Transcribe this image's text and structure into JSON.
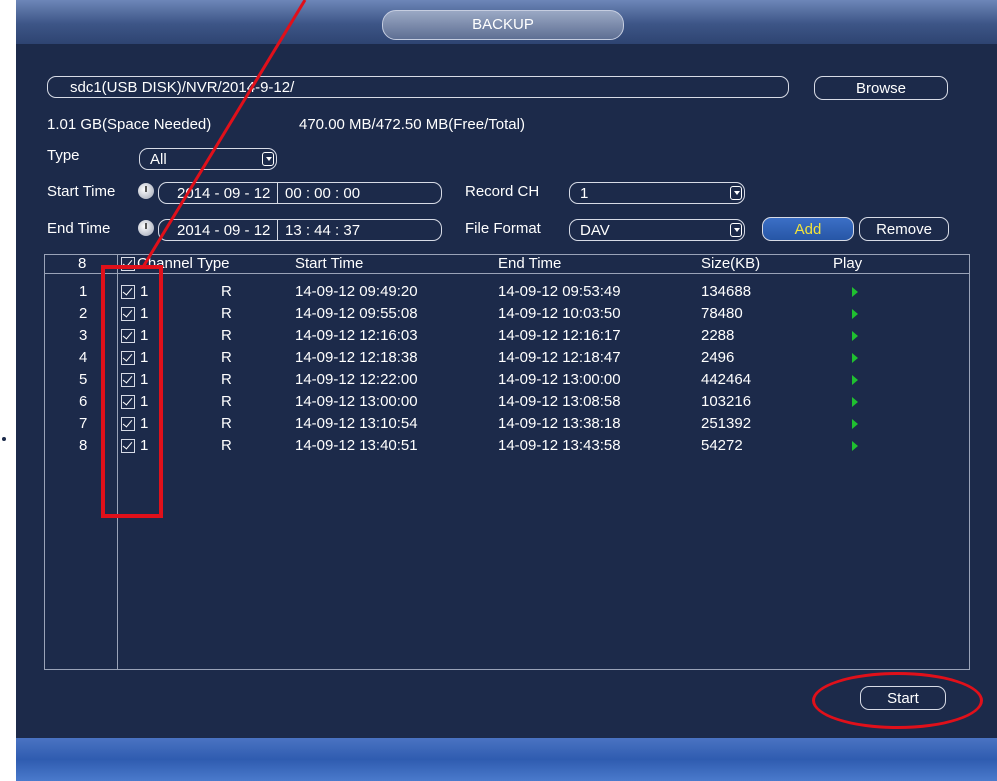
{
  "window": {
    "title": "BACKUP"
  },
  "path_bar": {
    "value": "sdc1(USB DISK)/NVR/2014-9-12/",
    "browse_label": "Browse"
  },
  "space": {
    "needed": "1.01 GB(Space Needed)",
    "free_total": "470.00 MB/472.50 MB(Free/Total)"
  },
  "filters": {
    "type_label": "Type",
    "type_value": "All",
    "start_time_label": "Start Time",
    "start_date": "2014 - 09 - 12",
    "start_time": "00 : 00 : 00",
    "end_time_label": "End Time",
    "end_date": "2014 - 09 - 12",
    "end_time": "13 : 44 : 37",
    "record_ch_label": "Record CH",
    "record_ch_value": "1",
    "file_format_label": "File Format",
    "file_format_value": "DAV",
    "add_label": "Add",
    "remove_label": "Remove"
  },
  "table": {
    "count": "8",
    "headers": {
      "channel": "Channel",
      "type": "Type",
      "start": "Start Time",
      "end": "End Time",
      "size": "Size(KB)",
      "play": "Play"
    },
    "rows": [
      {
        "num": "1",
        "channel": "1",
        "type": "R",
        "start": "14-09-12 09:49:20",
        "end": "14-09-12 09:53:49",
        "size": "134688",
        "checked": true
      },
      {
        "num": "2",
        "channel": "1",
        "type": "R",
        "start": "14-09-12 09:55:08",
        "end": "14-09-12 10:03:50",
        "size": "78480",
        "checked": true
      },
      {
        "num": "3",
        "channel": "1",
        "type": "R",
        "start": "14-09-12 12:16:03",
        "end": "14-09-12 12:16:17",
        "size": "2288",
        "checked": true
      },
      {
        "num": "4",
        "channel": "1",
        "type": "R",
        "start": "14-09-12 12:18:38",
        "end": "14-09-12 12:18:47",
        "size": "2496",
        "checked": true
      },
      {
        "num": "5",
        "channel": "1",
        "type": "R",
        "start": "14-09-12 12:22:00",
        "end": "14-09-12 13:00:00",
        "size": "442464",
        "checked": true
      },
      {
        "num": "6",
        "channel": "1",
        "type": "R",
        "start": "14-09-12 13:00:00",
        "end": "14-09-12 13:08:58",
        "size": "103216",
        "checked": true
      },
      {
        "num": "7",
        "channel": "1",
        "type": "R",
        "start": "14-09-12 13:10:54",
        "end": "14-09-12 13:38:18",
        "size": "251392",
        "checked": true
      },
      {
        "num": "8",
        "channel": "1",
        "type": "R",
        "start": "14-09-12 13:40:51",
        "end": "14-09-12 13:43:58",
        "size": "54272",
        "checked": true
      }
    ]
  },
  "actions": {
    "start_label": "Start"
  },
  "colors": {
    "annotation": "#e0101a",
    "play_icon": "#1fc030",
    "add_text": "#f2e33a",
    "panel_bg": "#1c2a4a"
  }
}
